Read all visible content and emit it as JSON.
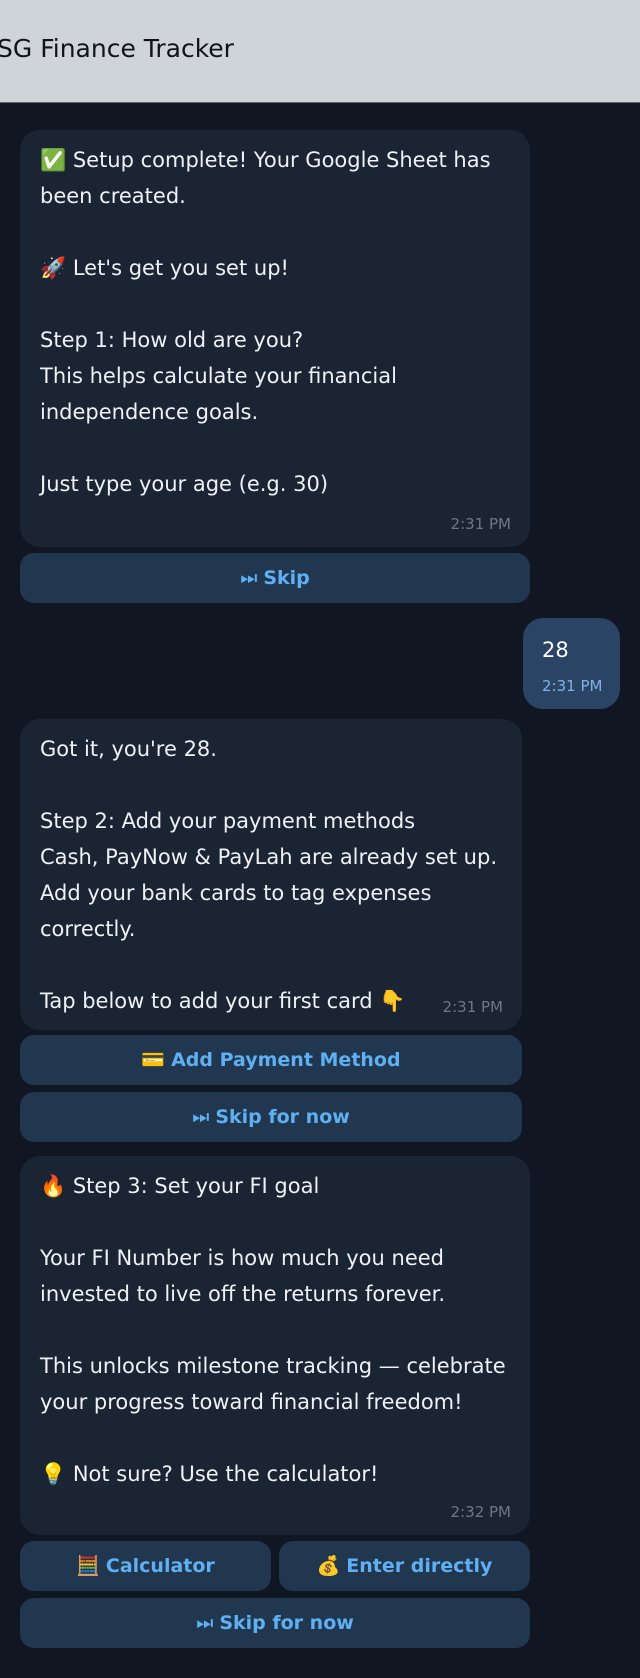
{
  "header": {
    "title": "SG Finance Tracker"
  },
  "messages": [
    {
      "text": "✅ Setup complete! Your Google Sheet has\nbeen created.\n\n🚀 Let's get you set up!\n\nStep 1: How old are you?\nThis helps calculate your financial\nindependence goals.\n\nJust type your age (e.g. 30)",
      "time": "2:31 PM",
      "buttons": [
        {
          "icon": "⏭",
          "label": "Skip"
        }
      ]
    },
    {
      "user": true,
      "text": "28",
      "time": "2:31 PM"
    },
    {
      "text": "Got it, you're 28.\n\nStep 2: Add your payment methods\nCash, PayNow & PayLah are already set up.\nAdd your bank cards to tag expenses correctly.\n\nTap below to add your first card 👇",
      "time": "2:31 PM",
      "buttons": [
        {
          "icon": "💳",
          "label": "Add Payment Method"
        },
        {
          "icon": "⏭",
          "label": "Skip for now"
        }
      ]
    },
    {
      "text": "🔥 Step 3: Set your FI goal\n\nYour FI Number is how much you need\ninvested to live off the returns forever.\n\nThis unlocks milestone tracking — celebrate\nyour progress toward financial freedom!\n\n💡 Not sure? Use the calculator!",
      "time": "2:32 PM",
      "buttons": [
        {
          "icon": "🧮",
          "label": "Calculator"
        },
        {
          "icon": "💰",
          "label": "Enter directly"
        },
        {
          "icon": "⏭",
          "label": "Skip for now"
        }
      ]
    }
  ],
  "colors": {
    "background": "#101722",
    "bubble": "#1b2433",
    "user_bubble": "#2b4364",
    "button": "#213750",
    "button_text": "#5fb0f2"
  }
}
